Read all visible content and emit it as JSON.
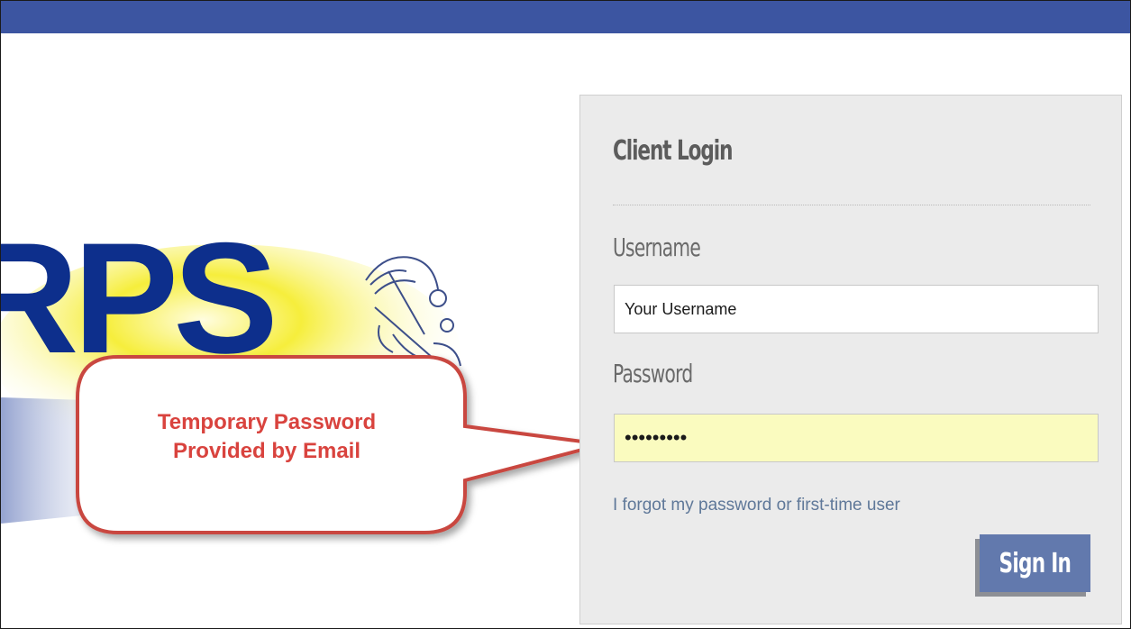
{
  "login": {
    "title": "Client Login",
    "username_label": "Username",
    "username_value": "Your Username",
    "password_label": "Password",
    "password_value": "•••••••••",
    "forgot_link": "I forgot my password or first-time user",
    "signin_button": "Sign In"
  },
  "logo": {
    "text": "RPS"
  },
  "callout": {
    "line1": "Temporary Password",
    "line2": "Provided by Email"
  },
  "colors": {
    "top_bar": "#3c55a1",
    "panel_bg": "#ebebeb",
    "password_highlight": "#fafbbf",
    "link": "#5f7899",
    "button": "#6279ad",
    "callout_text": "#d9433e",
    "callout_border": "#c9473f",
    "logo_blue": "#0d2f8c",
    "logo_yellow": "#f4e92a"
  }
}
